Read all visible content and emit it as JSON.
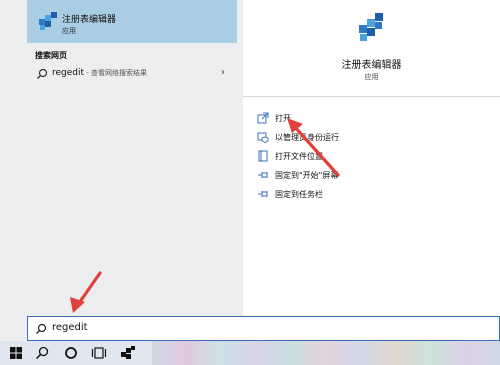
{
  "left_pane": {
    "best_match": {
      "title": "注册表编辑器",
      "subtitle": "应用"
    },
    "section_label": "搜索网页",
    "web_result": {
      "query": "regedit",
      "hint": " - 查看网络搜索结果",
      "chevron": "›"
    }
  },
  "right_pane": {
    "app_title": "注册表编辑器",
    "app_subtitle": "应用",
    "actions": [
      {
        "label": "打开",
        "icon": "open-icon"
      },
      {
        "label": "以管理员身份运行",
        "icon": "shield-icon"
      },
      {
        "label": "打开文件位置",
        "icon": "folder-icon"
      },
      {
        "label": "固定到\"开始\"屏幕",
        "icon": "pin-icon"
      },
      {
        "label": "固定到任务栏",
        "icon": "pin-icon"
      }
    ]
  },
  "search_box": {
    "value": "regedit",
    "icon": "search-icon"
  },
  "taskbar": {
    "items": [
      "windows-start-icon",
      "search-icon",
      "cortana-icon",
      "task-view-icon",
      "regedit-app-icon"
    ]
  },
  "colors": {
    "selection": "#a9cde3",
    "accent": "#3b6fb6",
    "annotation_arrow": "#e0413b"
  }
}
